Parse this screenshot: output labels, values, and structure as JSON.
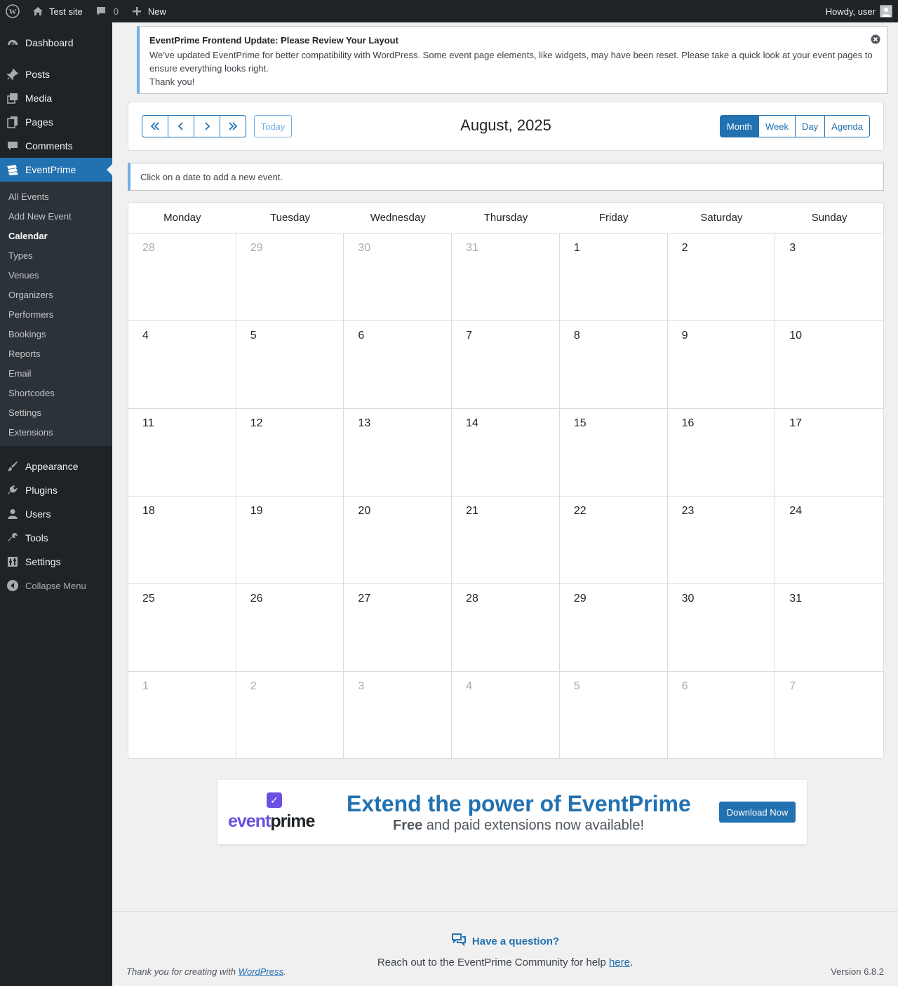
{
  "adminbar": {
    "site_name": "Test site",
    "comments_count": "0",
    "new_label": "New",
    "greeting": "Howdy, user"
  },
  "sidebar": {
    "items_top": [
      {
        "label": "Dashboard",
        "icon": "dashboard-icon"
      },
      {
        "label": "Posts",
        "icon": "pin-icon"
      },
      {
        "label": "Media",
        "icon": "media-icon"
      },
      {
        "label": "Pages",
        "icon": "pages-icon"
      },
      {
        "label": "Comments",
        "icon": "comment-icon"
      },
      {
        "label": "EventPrime",
        "icon": "eventprime-icon"
      }
    ],
    "submenu": [
      "All Events",
      "Add New Event",
      "Calendar",
      "Types",
      "Venues",
      "Organizers",
      "Performers",
      "Bookings",
      "Reports",
      "Email",
      "Shortcodes",
      "Settings",
      "Extensions"
    ],
    "items_bottom": [
      {
        "label": "Appearance",
        "icon": "brush-icon"
      },
      {
        "label": "Plugins",
        "icon": "plugin-icon"
      },
      {
        "label": "Users",
        "icon": "user-icon"
      },
      {
        "label": "Tools",
        "icon": "wrench-icon"
      },
      {
        "label": "Settings",
        "icon": "settings-icon"
      }
    ],
    "collapse_label": "Collapse Menu"
  },
  "notice": {
    "title": "EventPrime Frontend Update: Please Review Your Layout",
    "body": "We’ve updated EventPrime for better compatibility with WordPress. Some event page elements, like widgets, may have been reset. Please take a quick look at your event pages to ensure everything looks right.",
    "thanks": "Thank you!"
  },
  "calendar": {
    "today_label": "Today",
    "title": "August, 2025",
    "views": [
      "Month",
      "Week",
      "Day",
      "Agenda"
    ],
    "active_view": "Month",
    "info": "Click on a date to add a new event.",
    "weekdays": [
      "Monday",
      "Tuesday",
      "Wednesday",
      "Thursday",
      "Friday",
      "Saturday",
      "Sunday"
    ],
    "days": [
      {
        "d": "28",
        "other": true
      },
      {
        "d": "29",
        "other": true
      },
      {
        "d": "30",
        "other": true
      },
      {
        "d": "31",
        "other": true
      },
      {
        "d": "1"
      },
      {
        "d": "2"
      },
      {
        "d": "3"
      },
      {
        "d": "4"
      },
      {
        "d": "5"
      },
      {
        "d": "6"
      },
      {
        "d": "7"
      },
      {
        "d": "8"
      },
      {
        "d": "9"
      },
      {
        "d": "10"
      },
      {
        "d": "11"
      },
      {
        "d": "12"
      },
      {
        "d": "13"
      },
      {
        "d": "14"
      },
      {
        "d": "15"
      },
      {
        "d": "16"
      },
      {
        "d": "17"
      },
      {
        "d": "18"
      },
      {
        "d": "19"
      },
      {
        "d": "20"
      },
      {
        "d": "21"
      },
      {
        "d": "22"
      },
      {
        "d": "23"
      },
      {
        "d": "24"
      },
      {
        "d": "25"
      },
      {
        "d": "26"
      },
      {
        "d": "27"
      },
      {
        "d": "28"
      },
      {
        "d": "29"
      },
      {
        "d": "30"
      },
      {
        "d": "31"
      },
      {
        "d": "1",
        "other": true
      },
      {
        "d": "2",
        "other": true
      },
      {
        "d": "3",
        "other": true
      },
      {
        "d": "4",
        "other": true
      },
      {
        "d": "5",
        "other": true
      },
      {
        "d": "6",
        "other": true
      },
      {
        "d": "7",
        "other": true
      }
    ]
  },
  "promo": {
    "logo_event": "event",
    "logo_prime": "prime",
    "headline": "Extend the power of EventPrime",
    "sub_bold": "Free",
    "sub_rest": " and paid extensions now available!",
    "button": "Download Now"
  },
  "footer": {
    "question_title": "Have a question?",
    "question_text": "Reach out to the EventPrime Community for help ",
    "question_link": "here",
    "question_end": ".",
    "thanks_text": "Thank you for creating with ",
    "thanks_link": "WordPress",
    "thanks_end": ".",
    "version": "Version 6.8.2"
  },
  "colors": {
    "accent": "#2271b1",
    "admin_bg": "#1d2327",
    "notice_border": "#72aee6"
  }
}
